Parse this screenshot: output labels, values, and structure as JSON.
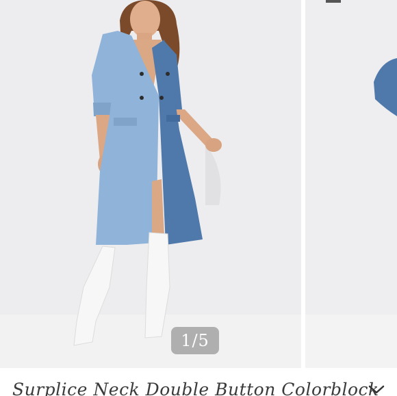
{
  "carousel": {
    "counter": "1/5",
    "slides": [
      {
        "subject": "model-wearing-colorblock-denim-dress",
        "active": true
      },
      {
        "subject": "next-product-photo",
        "active": false
      }
    ]
  },
  "product": {
    "title": "Surplice Neck Double Button Colorblock"
  },
  "colors": {
    "light_denim": "#8fb3d9",
    "dark_denim": "#4f79ab",
    "background": "#ececee",
    "boots": "#f7f7f7",
    "counter_bg": "#787878"
  },
  "icons": {
    "expand": "chevron-down-icon"
  }
}
